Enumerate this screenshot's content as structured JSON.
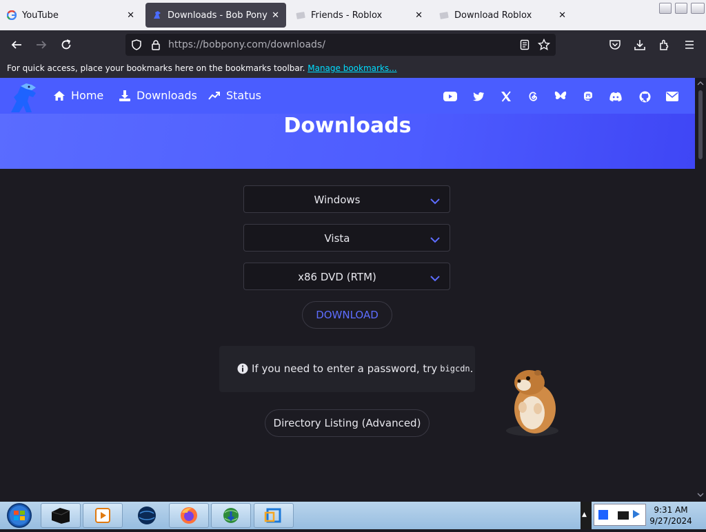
{
  "browser": {
    "tabs": [
      {
        "label": "YouTube",
        "active": false,
        "icon": "google-g-icon"
      },
      {
        "label": "Downloads - Bob Pony",
        "active": true,
        "icon": "bobpony-icon"
      },
      {
        "label": "Friends - Roblox",
        "active": false,
        "icon": "roblox-icon"
      },
      {
        "label": "Download Roblox",
        "active": false,
        "icon": "roblox-icon"
      }
    ],
    "url_host": "https://bobpony.com",
    "url_path": "/downloads/",
    "bookmarks_text": "For quick access, place your bookmarks here on the bookmarks toolbar.",
    "bookmarks_link": "Manage bookmarks..."
  },
  "site": {
    "nav": {
      "home": "Home",
      "downloads": "Downloads",
      "status": "Status"
    },
    "social": [
      "youtube-icon",
      "twitter-icon",
      "x-icon",
      "threads-icon",
      "bluesky-icon",
      "mastodon-icon",
      "discord-icon",
      "github-icon",
      "mail-icon"
    ],
    "title": "Downloads",
    "selects": {
      "os": "Windows",
      "version": "Vista",
      "build": "x86 DVD (RTM)"
    },
    "download_button": "DOWNLOAD",
    "notice_text": "If you need to enter a password, try",
    "notice_code": "bigcdn",
    "notice_end": ".",
    "directory_button": "Directory Listing (Advanced)"
  },
  "taskbar": {
    "time": "9:31 AM",
    "date": "9/27/2024"
  },
  "colors": {
    "accent": "#4a5dff",
    "background": "#1c1b22",
    "link": "#00ddff"
  }
}
